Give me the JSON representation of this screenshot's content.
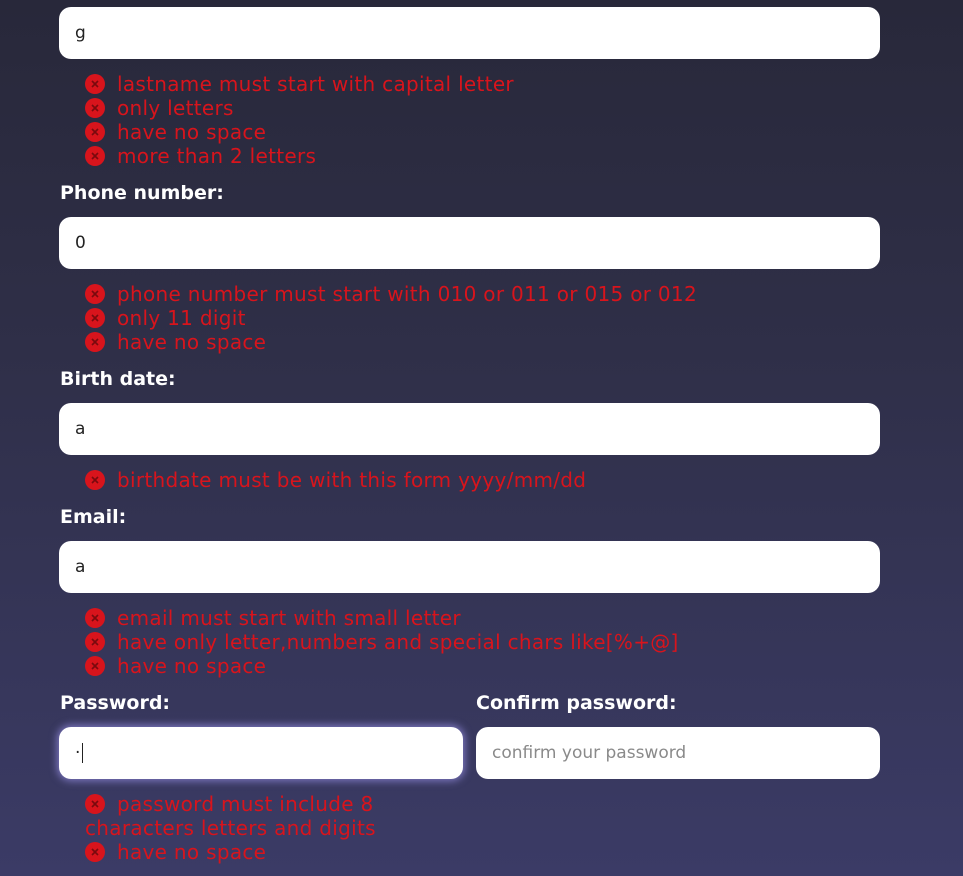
{
  "lastname": {
    "value": "g",
    "errors": [
      "lastname must start with capital letter",
      "only letters",
      "have no space",
      "more than 2 letters"
    ]
  },
  "phone": {
    "label": "Phone number:",
    "value": "0",
    "errors": [
      "phone number must start with 010 or 011 or 015 or 012",
      "only 11 digit",
      "have no space"
    ]
  },
  "birthdate": {
    "label": "Birth date:",
    "value": "a",
    "errors": [
      "birthdate must be with this form yyyy/mm/dd"
    ]
  },
  "email": {
    "label": "Email:",
    "value": "a",
    "errors": [
      "email must start with small letter",
      "have only letter,numbers and special chars like[%+@]",
      "have no space"
    ]
  },
  "password": {
    "label": "Password:",
    "value": "·",
    "errors": [
      "password must include 8",
      "characters letters and digits",
      "have no space"
    ]
  },
  "confirm_password": {
    "label": "Confirm password:",
    "placeholder": "confirm your password"
  },
  "colors": {
    "error": "#d8141c",
    "label": "#ffffff",
    "field_bg": "#ffffff"
  },
  "icons": {
    "error": "error-x-icon"
  }
}
